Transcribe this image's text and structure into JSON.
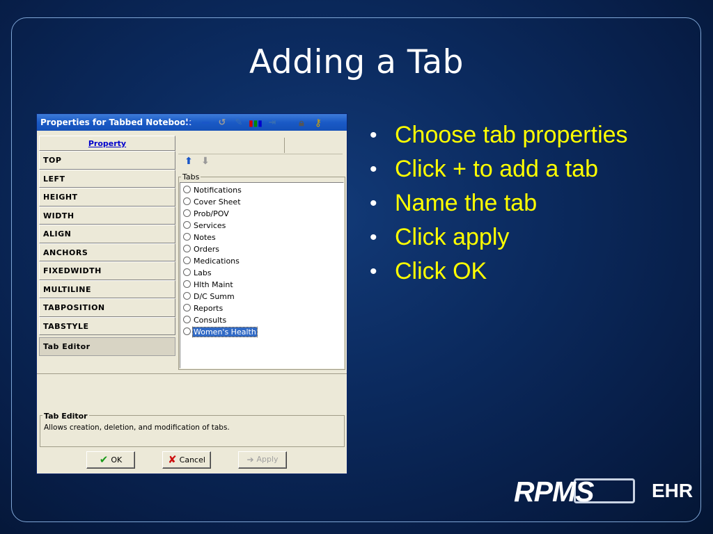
{
  "slide": {
    "title": "Adding a Tab"
  },
  "dialog": {
    "title": "Properties for Tabbed Notebook",
    "property_header": "Property",
    "properties": [
      "TOP",
      "LEFT",
      "HEIGHT",
      "WIDTH",
      "ALIGN",
      "ANCHORS",
      "FIXEDWIDTH",
      "MULTILINE",
      "TABPOSITION",
      "TABSTYLE",
      "Tab Editor"
    ],
    "tabs_label": "Tabs",
    "tabs": [
      "Notifications",
      "Cover Sheet",
      "Prob/POV",
      "Services",
      "Notes",
      "Orders",
      "Medications",
      "Labs",
      "Hlth Maint",
      "D/C Summ",
      "Reports",
      "Consults",
      "Women's Health"
    ],
    "selected_tab": "Women's Health",
    "editor": {
      "title": "Tab Editor",
      "description": "Allows creation, deletion, and modification of tabs."
    },
    "buttons": {
      "ok": "OK",
      "cancel": "Cancel",
      "apply": "Apply"
    },
    "toolbar_icons": [
      "add-icon",
      "remove-icon",
      "undo-icon",
      "edit-icon",
      "books-icon",
      "import-icon",
      "lock-icon",
      "key-icon",
      "move-up-icon",
      "move-down-icon"
    ]
  },
  "bullets": [
    "Choose tab properties",
    "Click + to add a tab",
    "Name the tab",
    "Click apply",
    "Click OK"
  ],
  "logo": {
    "rpms": "RPMS",
    "ehr": "EHR"
  },
  "colors": {
    "background": "#0b2a5e",
    "bullet_text": "#ffff00",
    "title_bar": "#1a5ac6",
    "selection": "#316ac5"
  }
}
